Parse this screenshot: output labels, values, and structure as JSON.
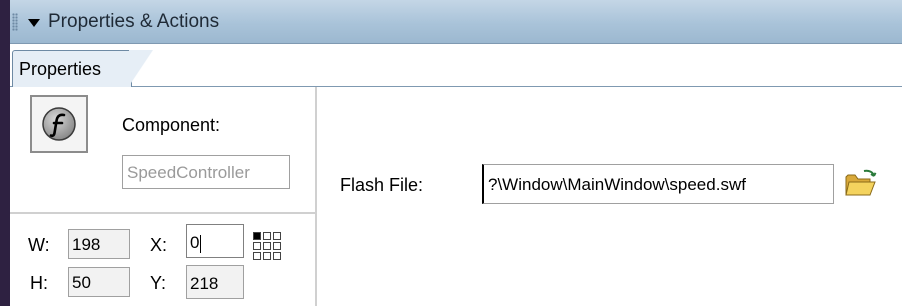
{
  "panel": {
    "title": "Properties & Actions"
  },
  "tabs": [
    {
      "label": "Properties"
    }
  ],
  "component": {
    "label": "Component:",
    "name_value": "SpeedController",
    "icon": "flash-icon"
  },
  "dimensions": {
    "w_label": "W:",
    "w_value": "198",
    "h_label": "H:",
    "h_value": "50",
    "x_label": "X:",
    "x_value": "0",
    "y_label": "Y:",
    "y_value": "218",
    "registration_icon": "registration-point-grid-icon"
  },
  "flash_file": {
    "label": "Flash File:",
    "value": "?\\Window\\MainWindow\\speed.swf",
    "browse_icon": "open-folder-icon"
  },
  "colors": {
    "background": "#2e2141",
    "titlebar": "#a9c3d9",
    "tab": "#e6eef6"
  }
}
